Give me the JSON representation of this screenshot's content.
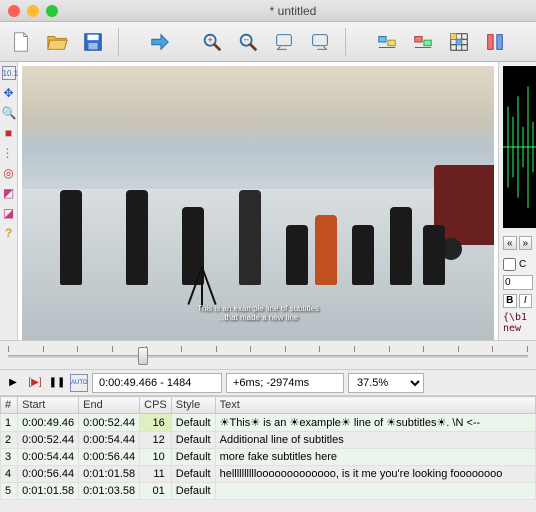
{
  "window": {
    "title": "* untitled"
  },
  "toolbar": {
    "new": "New",
    "open": "Open",
    "save": "Save",
    "fwd": "Forward",
    "zoomin": "Zoom In",
    "zoomout": "Zoom Out",
    "shiftback": "Shift Back",
    "shiftfwd": "Shift Forward",
    "style1": "Styles",
    "style2": "Properties",
    "grid": "Grid",
    "extra": "Extra"
  },
  "lefttools": {
    "ruler": "10.1",
    "move": "✥",
    "mag": "🔍",
    "stop": "■",
    "dots": "⋮⋮",
    "target": "◎",
    "mask1": "◩",
    "mask2": "◪",
    "help": "?"
  },
  "preview": {
    "sub1": "This is an example line of subtitles",
    "sub2": "...that made a new line"
  },
  "rightpane": {
    "scrollL": "«",
    "scrollR": "»",
    "checkC": "C",
    "numval": "0",
    "bold": "B",
    "italic": "I",
    "code1": "{\\b1",
    "code2": "new"
  },
  "controls": {
    "play": "▶",
    "playend": "[▶]",
    "pause": "❚❚",
    "auto": "AUTO",
    "timecode": "0:00:49.466 - 1484",
    "offset": "+6ms; -2974ms",
    "zoom": "37.5%"
  },
  "table": {
    "headers": {
      "n": "#",
      "start": "Start",
      "end": "End",
      "cps": "CPS",
      "style": "Style",
      "text": "Text"
    },
    "rows": [
      {
        "n": "1",
        "start": "0:00:49.46",
        "end": "0:00:52.44",
        "cps": "16",
        "style": "Default",
        "text": "☀This☀ is an ☀example☀ line of ☀subtitles☀.  \\N <--"
      },
      {
        "n": "2",
        "start": "0:00:52.44",
        "end": "0:00:54.44",
        "cps": "12",
        "style": "Default",
        "text": "Additional line of subtitles"
      },
      {
        "n": "3",
        "start": "0:00:54.44",
        "end": "0:00:56.44",
        "cps": "10",
        "style": "Default",
        "text": "more fake subtitles here"
      },
      {
        "n": "4",
        "start": "0:00:56.44",
        "end": "0:01:01.58",
        "cps": "11",
        "style": "Default",
        "text": "hellllllllllooooooooooooo, is it me you're looking foooooooo"
      },
      {
        "n": "5",
        "start": "0:01:01.58",
        "end": "0:01:03.58",
        "cps": "01",
        "style": "Default",
        "text": ""
      }
    ]
  }
}
